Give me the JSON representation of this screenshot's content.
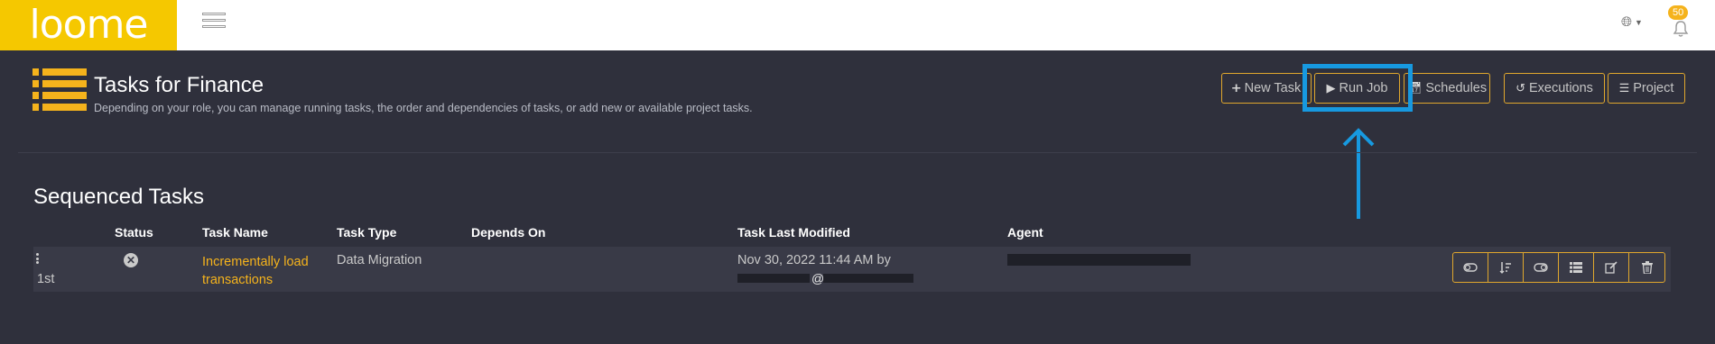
{
  "app": {
    "logo_text": "loome"
  },
  "topbar": {
    "menu_icon": "hamburger-icon",
    "globe_icon": "globe-icon",
    "notifications": {
      "icon": "bell-icon",
      "count": "50"
    }
  },
  "header": {
    "title": "Tasks for Finance",
    "subtitle": "Depending on your role, you can manage running tasks, the order and dependencies of tasks, or add new or available project tasks.",
    "icon": "list-icon"
  },
  "toolbar": {
    "new_task": "New Task",
    "run_job": "Run Job",
    "schedules": "Schedules",
    "executions": "Executions",
    "project": "Project"
  },
  "section": {
    "title": "Sequenced Tasks",
    "columns": {
      "status": "Status",
      "task_name": "Task Name",
      "task_type": "Task Type",
      "depends_on": "Depends On",
      "last_modified": "Task Last Modified",
      "agent": "Agent"
    },
    "rows": [
      {
        "order": "1st",
        "status_icon": "times-circle-icon",
        "task_name": "Incrementally load transactions",
        "task_type": "Data Migration",
        "depends_on": "",
        "last_modified": "Nov 30, 2022 11:44 AM by",
        "modified_by_separator": "@"
      }
    ]
  },
  "row_actions": [
    "toggle-icon",
    "sort-icon",
    "toggle-icon",
    "list-icon",
    "edit-icon",
    "trash-icon"
  ],
  "colors": {
    "accent": "#f5b31c",
    "logo_bg": "#f5c800",
    "background": "#2f303c",
    "highlight": "#1799e0"
  }
}
